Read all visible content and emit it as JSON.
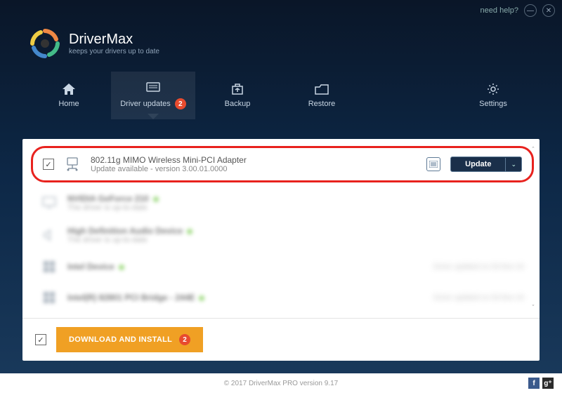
{
  "titlebar": {
    "help": "need help?"
  },
  "logo": {
    "title": "DriverMax",
    "subtitle": "keeps your drivers up to date"
  },
  "tabs": [
    {
      "label": "Home"
    },
    {
      "label": "Driver updates",
      "badge": "2"
    },
    {
      "label": "Backup"
    },
    {
      "label": "Restore"
    },
    {
      "label": "Settings"
    }
  ],
  "featured": {
    "title": "802.11g MIMO Wireless Mini-PCI Adapter",
    "subtitle": "Update available - version 3.00.01.0000",
    "button": "Update"
  },
  "items": [
    {
      "title": "NVIDIA GeForce 210",
      "subtitle": "The driver is up-to-date"
    },
    {
      "title": "High Definition Audio Device",
      "subtitle": "The driver is up-to-date"
    },
    {
      "title": "Intel Device",
      "subtitle": "",
      "meta": "Driver updated on 03-Nov-16"
    },
    {
      "title": "Intel(R) 82801 PCI Bridge - 244E",
      "subtitle": "",
      "meta": "Driver updated on 03-Nov-16"
    }
  ],
  "download": {
    "label": "DOWNLOAD AND INSTALL",
    "badge": "2"
  },
  "footer": {
    "copyright": "© 2017 DriverMax PRO version 9.17"
  }
}
